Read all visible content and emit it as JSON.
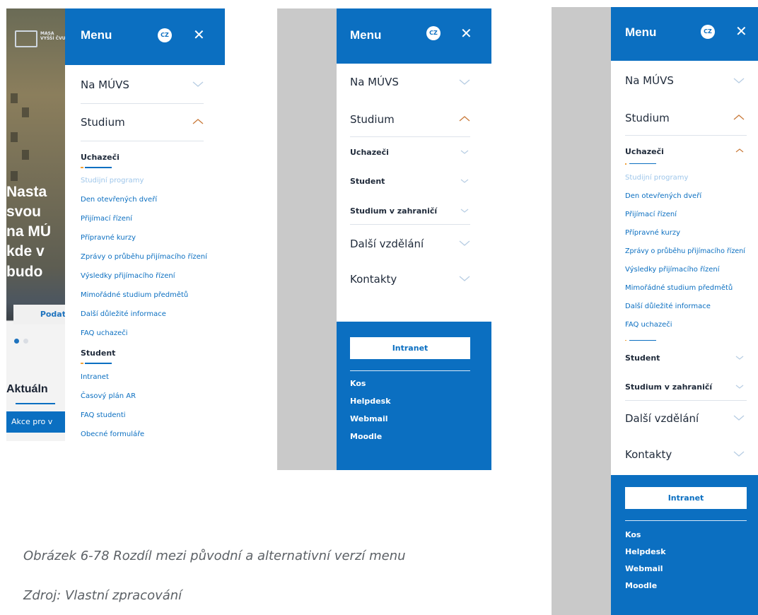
{
  "panel1": {
    "background": {
      "logo_text": "MASA VYŠŠÍ ČVUT",
      "hero_lines": [
        "Nasta",
        "svou",
        "na MÚ",
        "kde v",
        "budo"
      ],
      "cta_label": "Podat",
      "section_heading": "Aktuáln",
      "section_button": "Akce pro v"
    },
    "menu": {
      "title": "Menu",
      "lang": "CZ",
      "close": "✕",
      "items": [
        {
          "label": "Na MÚVS",
          "state": "collapsed"
        },
        {
          "label": "Studium",
          "state": "expanded"
        }
      ],
      "groups": [
        {
          "label": "Uchazeči",
          "links": [
            "Studijní programy",
            "Den otevřených dveří",
            "Přijímací řízení",
            "Přípravné kurzy",
            "Zprávy o průběhu přijímacího řízení",
            "Výsledky přijímacího řízení",
            "Mimořádné studium předmětů",
            "Další důležité informace",
            "FAQ uchazeči"
          ]
        },
        {
          "label": "Student",
          "links": [
            "Intranet",
            "Časový plán AR",
            "FAQ studenti",
            "Obecné formuláře"
          ]
        }
      ]
    }
  },
  "panel2": {
    "menu": {
      "title": "Menu",
      "lang": "CZ",
      "close": "✕",
      "items": [
        "Na MÚVS",
        "Studium"
      ],
      "subitems": [
        "Uchazeči",
        "Student",
        "Studium v zahraničí"
      ],
      "items_after": [
        "Další vzdělání",
        "Kontakty"
      ]
    },
    "footer": {
      "button": "Intranet",
      "links": [
        "Kos",
        "Helpdesk",
        "Webmail",
        "Moodle"
      ]
    }
  },
  "panel3": {
    "menu": {
      "title": "Menu",
      "lang": "CZ",
      "close": "✕",
      "items": [
        "Na MÚVS",
        "Studium"
      ],
      "group_open": "Uchazeči",
      "links": [
        "Studijní programy",
        "Den otevřených dveří",
        "Přijímací řízení",
        "Přípravné kurzy",
        "Zprávy o průběhu přijímacího řízení",
        "Výsledky přijímacího řízení",
        "Mimořádné studium předmětů",
        "Další důležité informace",
        "FAQ uchazeči"
      ],
      "subitems": [
        "Student",
        "Studium v zahraničí"
      ],
      "items_after": [
        "Další vzdělání",
        "Kontakty"
      ]
    },
    "footer": {
      "button": "Intranet",
      "links": [
        "Kos",
        "Helpdesk",
        "Webmail",
        "Moodle"
      ]
    }
  },
  "captions": {
    "figure": "Obrázek 6-78 Rozdíl mezi původní a alternativní verzí menu",
    "source": "Zdroj: Vlastní zpracování"
  },
  "colors": {
    "brand_blue": "#0b6fc1",
    "link_muted": "#9ec6ea",
    "chevron_up": "#c97a3a",
    "chevron_down": "#b7cde3",
    "side_grey": "#c9c9c9"
  }
}
